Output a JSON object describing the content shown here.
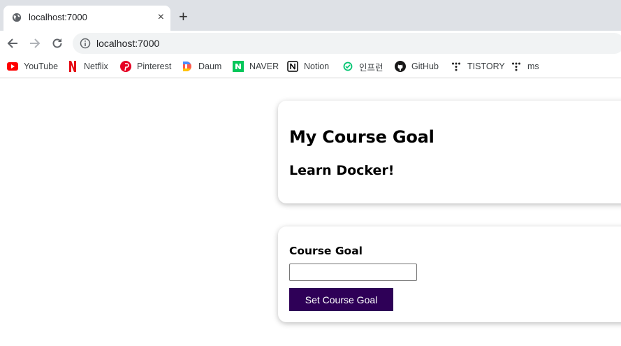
{
  "tab": {
    "title": "localhost:7000",
    "favicon": "globe-icon",
    "close": "×"
  },
  "new_tab": "+",
  "toolbar": {
    "url": "localhost:7000"
  },
  "bookmarks": [
    {
      "label": "YouTube",
      "icon": "youtube-icon"
    },
    {
      "label": "Netflix",
      "icon": "netflix-icon"
    },
    {
      "label": "Pinterest",
      "icon": "pinterest-icon"
    },
    {
      "label": "Daum",
      "icon": "daum-icon"
    },
    {
      "label": "NAVER",
      "icon": "naver-icon"
    },
    {
      "label": "Notion",
      "icon": "notion-icon"
    },
    {
      "label": "인프런",
      "icon": "inflearn-icon"
    },
    {
      "label": "GitHub",
      "icon": "github-icon"
    },
    {
      "label": "TISTORY",
      "icon": "tistory-icon"
    },
    {
      "label": "ms",
      "icon": "ms-icon"
    }
  ],
  "goal_card": {
    "title": "My Course Goal",
    "goal": "Learn Docker!"
  },
  "form_card": {
    "label": "Course Goal",
    "input_value": "",
    "button_label": "Set Course Goal"
  },
  "colors": {
    "button": "#2e0057",
    "tabstrip": "#dee1e6"
  }
}
